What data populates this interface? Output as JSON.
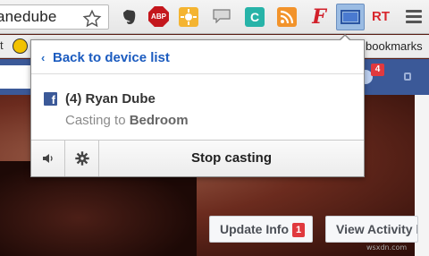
{
  "browser": {
    "omnibox_text": "anedube",
    "extensions": [
      {
        "name": "evernote-icon"
      },
      {
        "name": "adblock-plus-icon",
        "label": "ABP"
      },
      {
        "name": "sun-icon"
      },
      {
        "name": "chat-icon"
      },
      {
        "name": "c-extension-icon",
        "label": "C"
      },
      {
        "name": "rss-icon"
      },
      {
        "name": "f-extension-icon",
        "label": "F"
      },
      {
        "name": "cast-icon"
      },
      {
        "name": "rt-extension-icon",
        "label": "RT"
      },
      {
        "name": "chrome-menu-icon"
      }
    ],
    "bookmarks_label": "bookmarks",
    "bookmarks_edge_text": "t"
  },
  "page": {
    "notification_count": "4",
    "update_info_label": "Update Info",
    "update_info_badge": "1",
    "view_activity_label": "View Activity l",
    "watermark": "wsxdn.com"
  },
  "cast_popup": {
    "back_label": "Back to device list",
    "back_chevron": "‹",
    "tab_title": "(4) Ryan Dube",
    "casting_prefix": "Casting to",
    "device_name": "Bedroom",
    "stop_label": "Stop casting",
    "favicon_letter": "f"
  },
  "colors": {
    "link_blue": "#1b5bbf",
    "facebook_blue": "#3b5998",
    "badge_red": "#e0393e"
  }
}
